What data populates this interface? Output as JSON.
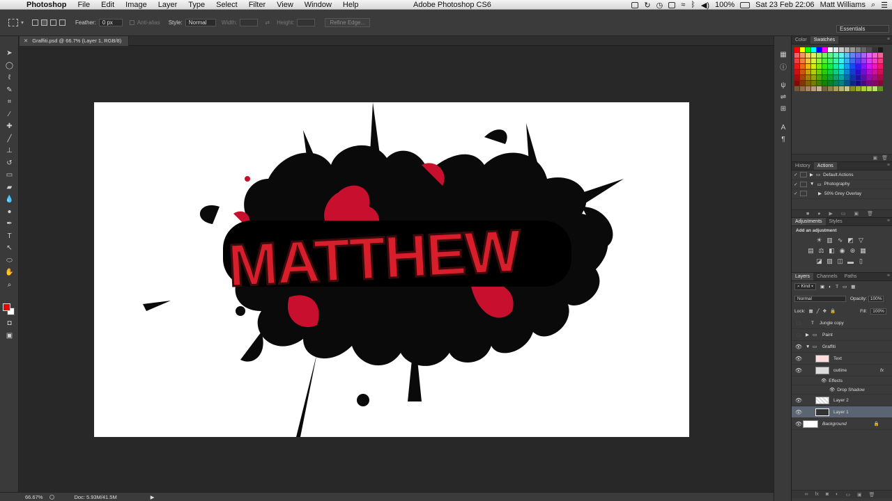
{
  "menubar": {
    "app": "Photoshop",
    "items": [
      "File",
      "Edit",
      "Image",
      "Layer",
      "Type",
      "Select",
      "Filter",
      "View",
      "Window",
      "Help"
    ],
    "window_title": "Adobe Photoshop CS6",
    "battery": "100%",
    "datetime": "Sat 23 Feb  22:06",
    "user": "Matt Williams"
  },
  "options": {
    "feather_label": "Feather:",
    "feather_value": "0 px",
    "antialias": "Anti-alias",
    "style_label": "Style:",
    "style_value": "Normal",
    "width_label": "Width:",
    "height_label": "Height:",
    "refine_edge": "Refine Edge...",
    "workspace": "Essentials"
  },
  "document_tab": "Graffiti.psd @ 66.7% (Layer 1, RGB/8)",
  "canvas": {
    "text": "MATTHEW"
  },
  "status": {
    "zoom": "66.67%",
    "doc": "Doc: 5.93M/41.5M"
  },
  "swatches_panel": {
    "tabs": [
      "Color",
      "Swatches"
    ],
    "active": "Swatches"
  },
  "actions_panel": {
    "tabs": [
      "History",
      "Actions"
    ],
    "active": "Actions",
    "rows": [
      "Default Actions",
      "Photography",
      "50% Grey Overlay"
    ]
  },
  "adjustments_panel": {
    "tabs": [
      "Adjustments",
      "Styles"
    ],
    "active": "Adjustments",
    "heading": "Add an adjustment"
  },
  "layers_panel": {
    "tabs": [
      "Layers",
      "Channels",
      "Paths"
    ],
    "active": "Layers",
    "kind": "Kind",
    "blend_mode": "Normal",
    "opacity_label": "Opacity:",
    "opacity": "100%",
    "lock_label": "Lock:",
    "fill_label": "Fill:",
    "fill": "100%",
    "layers": [
      "Jungle copy",
      "Paint",
      "Graffiti",
      "Text",
      "outline",
      "Effects",
      "Drop Shadow",
      "Layer 2",
      "Layer 1",
      "Background"
    ]
  },
  "colors": {
    "foreground": "#e00000",
    "background": "#ffffff",
    "accent": "#5a6472"
  }
}
